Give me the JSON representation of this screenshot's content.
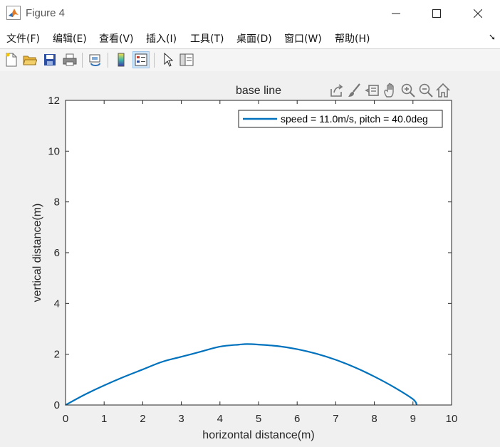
{
  "window": {
    "title": "Figure 4"
  },
  "menu": [
    "文件(F)",
    "编辑(E)",
    "查看(V)",
    "插入(I)",
    "工具(T)",
    "桌面(D)",
    "窗口(W)",
    "帮助(H)"
  ],
  "toolbar_icons": [
    "new-figure-icon",
    "open-icon",
    "save-icon",
    "print-icon",
    "link-plot-icon",
    "colorbar-icon",
    "legend-icon",
    "pointer-icon",
    "property-inspector-icon"
  ],
  "axes_toolbar_icons": [
    "export-icon",
    "brush-icon",
    "datatip-icon",
    "pan-icon",
    "zoom-in-icon",
    "zoom-out-icon",
    "home-icon"
  ],
  "colors": {
    "line": "#0072bd",
    "background": "#f0f0f0"
  },
  "chart_data": {
    "type": "line",
    "title": "base line",
    "xlabel": "horizontal distance(m)",
    "ylabel": "vertical distance(m)",
    "xlim": [
      0,
      10
    ],
    "ylim": [
      0,
      12
    ],
    "xticks": [
      "0",
      "1",
      "2",
      "3",
      "4",
      "5",
      "6",
      "7",
      "8",
      "9",
      "10"
    ],
    "yticks": [
      "0",
      "2",
      "4",
      "6",
      "8",
      "10",
      "12"
    ],
    "grid": false,
    "legend_position": "top-right",
    "series": [
      {
        "name": "speed = 11.0m/s, pitch = 40.0deg",
        "x": [
          0,
          0.5,
          1,
          1.5,
          2,
          2.5,
          3,
          3.5,
          4,
          4.5,
          4.7,
          5,
          5.5,
          6,
          6.5,
          7,
          7.5,
          8,
          8.5,
          9,
          9.1
        ],
        "y": [
          0,
          0.41,
          0.77,
          1.1,
          1.4,
          1.7,
          1.9,
          2.1,
          2.3,
          2.38,
          2.4,
          2.38,
          2.32,
          2.2,
          2.02,
          1.78,
          1.48,
          1.12,
          0.71,
          0.23,
          0.0
        ]
      }
    ]
  }
}
